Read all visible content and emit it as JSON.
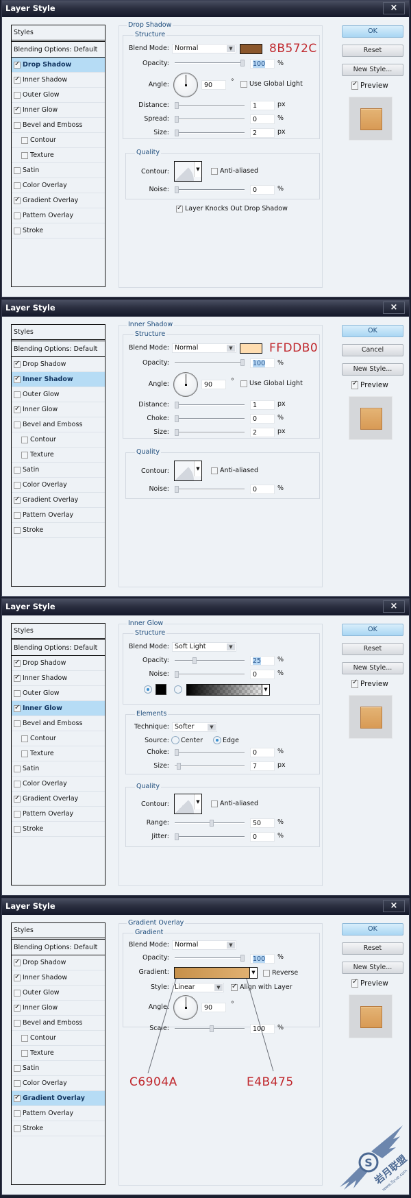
{
  "dialogs": [
    {
      "title": "Layer Style",
      "active_style": "Drop Shadow",
      "section_title": "Drop Shadow",
      "subsection_title": "Structure",
      "blend_mode": {
        "label": "Blend Mode:",
        "value": "Normal"
      },
      "color_swatch": "#8B572C",
      "color_callout": "8B572C",
      "opacity": {
        "label": "Opacity:",
        "value": "100",
        "unit": "%",
        "fraction": 1.0
      },
      "angle": {
        "label": "Angle:",
        "value": "90",
        "unit": "°"
      },
      "use_global_light": {
        "label": "Use Global Light",
        "checked": false
      },
      "distance": {
        "label": "Distance:",
        "value": "1",
        "unit": "px"
      },
      "spread": {
        "label": "Spread:",
        "value": "0",
        "unit": "%"
      },
      "size": {
        "label": "Size:",
        "value": "2",
        "unit": "px"
      },
      "quality_title": "Quality",
      "contour_label": "Contour:",
      "anti_aliased": {
        "label": "Anti-aliased",
        "checked": false
      },
      "noise": {
        "label": "Noise:",
        "value": "0",
        "unit": "%"
      },
      "knockout": {
        "label": "Layer Knocks Out Drop Shadow",
        "checked": true
      },
      "buttons": {
        "ok": "OK",
        "second": "Reset",
        "new_style": "New Style...",
        "preview": "Preview"
      }
    },
    {
      "title": "Layer Style",
      "active_style": "Inner Shadow",
      "section_title": "Inner Shadow",
      "subsection_title": "Structure",
      "blend_mode": {
        "label": "Blend Mode:",
        "value": "Normal"
      },
      "color_swatch": "#FFDDB0",
      "color_callout": "FFDDB0",
      "opacity": {
        "label": "Opacity:",
        "value": "100",
        "unit": "%",
        "fraction": 1.0
      },
      "angle": {
        "label": "Angle:",
        "value": "90",
        "unit": "°"
      },
      "use_global_light": {
        "label": "Use Global Light",
        "checked": false
      },
      "distance": {
        "label": "Distance:",
        "value": "1",
        "unit": "px"
      },
      "choke": {
        "label": "Choke:",
        "value": "0",
        "unit": "%"
      },
      "size": {
        "label": "Size:",
        "value": "2",
        "unit": "px"
      },
      "quality_title": "Quality",
      "contour_label": "Contour:",
      "anti_aliased": {
        "label": "Anti-aliased",
        "checked": false
      },
      "noise": {
        "label": "Noise:",
        "value": "0",
        "unit": "%"
      },
      "buttons": {
        "ok": "OK",
        "second": "Cancel",
        "new_style": "New Style...",
        "preview": "Preview"
      }
    },
    {
      "title": "Layer Style",
      "active_style": "Inner Glow",
      "section_title": "Inner Glow",
      "subsection_title": "Structure",
      "blend_mode": {
        "label": "Blend Mode:",
        "value": "Soft Light"
      },
      "opacity": {
        "label": "Opacity:",
        "value": "25",
        "unit": "%",
        "fraction": 0.25
      },
      "noise": {
        "label": "Noise:",
        "value": "0",
        "unit": "%"
      },
      "glow_color": "#000000",
      "elements_title": "Elements",
      "technique": {
        "label": "Technique:",
        "value": "Softer"
      },
      "source": {
        "label": "Source:",
        "center": "Center",
        "edge": "Edge",
        "selected": "Edge"
      },
      "choke": {
        "label": "Choke:",
        "value": "0",
        "unit": "%"
      },
      "size": {
        "label": "Size:",
        "value": "7",
        "unit": "px"
      },
      "quality_title": "Quality",
      "contour_label": "Contour:",
      "anti_aliased": {
        "label": "Anti-aliased",
        "checked": false
      },
      "range": {
        "label": "Range:",
        "value": "50",
        "unit": "%",
        "fraction": 0.5
      },
      "jitter": {
        "label": "Jitter:",
        "value": "0",
        "unit": "%"
      },
      "buttons": {
        "ok": "OK",
        "second": "Reset",
        "new_style": "New Style...",
        "preview": "Preview"
      }
    },
    {
      "title": "Layer Style",
      "active_style": "Gradient Overlay",
      "section_title": "Gradient Overlay",
      "subsection_title": "Gradient",
      "blend_mode": {
        "label": "Blend Mode:",
        "value": "Normal"
      },
      "opacity": {
        "label": "Opacity:",
        "value": "100",
        "unit": "%",
        "fraction": 1.0
      },
      "gradient": {
        "label": "Gradient:",
        "start": "#C6904A",
        "end": "#E4B475"
      },
      "reverse": {
        "label": "Reverse",
        "checked": false
      },
      "style": {
        "label": "Style:",
        "value": "Linear"
      },
      "align_with_layer": {
        "label": "Align with Layer",
        "checked": true
      },
      "angle": {
        "label": "Angle:",
        "value": "90",
        "unit": "°"
      },
      "scale": {
        "label": "Scale:",
        "value": "100",
        "unit": "%",
        "fraction": 0.5
      },
      "callout_start": "C6904A",
      "callout_end": "E4B475",
      "buttons": {
        "ok": "OK",
        "second": "Reset",
        "new_style": "New Style...",
        "preview": "Preview"
      }
    }
  ],
  "styles_list": {
    "header": "Styles",
    "blending": "Blending Options: Default",
    "items": [
      {
        "label": "Drop Shadow",
        "checked": true,
        "sub": false
      },
      {
        "label": "Inner Shadow",
        "checked": true,
        "sub": false
      },
      {
        "label": "Outer Glow",
        "checked": false,
        "sub": false
      },
      {
        "label": "Inner Glow",
        "checked": true,
        "sub": false
      },
      {
        "label": "Bevel and Emboss",
        "checked": false,
        "sub": false
      },
      {
        "label": "Contour",
        "checked": false,
        "sub": true
      },
      {
        "label": "Texture",
        "checked": false,
        "sub": true
      },
      {
        "label": "Satin",
        "checked": false,
        "sub": false
      },
      {
        "label": "Color Overlay",
        "checked": false,
        "sub": false
      },
      {
        "label": "Gradient Overlay",
        "checked": true,
        "sub": false
      },
      {
        "label": "Pattern Overlay",
        "checked": false,
        "sub": false
      },
      {
        "label": "Stroke",
        "checked": false,
        "sub": false
      }
    ]
  },
  "preview_colors": {
    "top": "#E4B475",
    "bottom": "#D89A55",
    "border": "#B5773A"
  },
  "close_icon": "×",
  "watermark": {
    "text": "岩月联盟",
    "url_text": "www.5yue.com",
    "badge": "S"
  }
}
